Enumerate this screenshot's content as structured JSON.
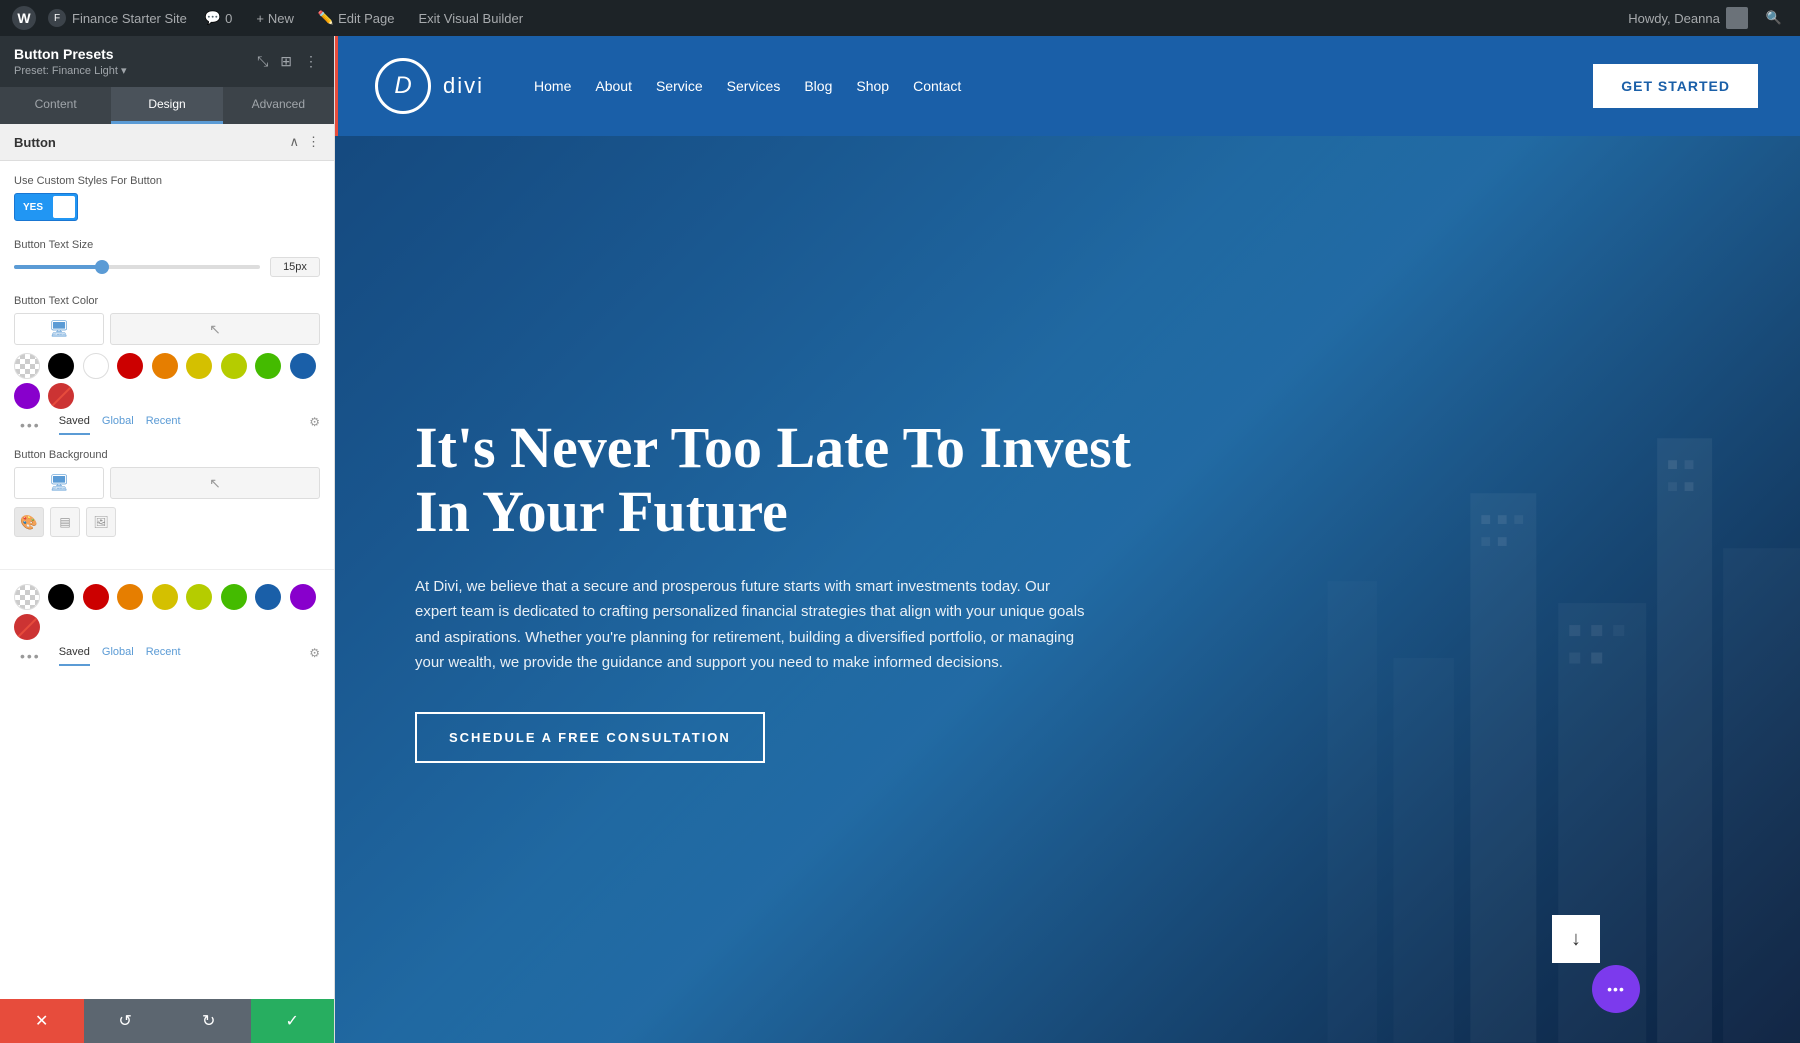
{
  "admin_bar": {
    "wp_icon": "W",
    "site_name": "Finance Starter Site",
    "comment_count": "0",
    "new_label": "New",
    "edit_page_label": "Edit Page",
    "exit_builder_label": "Exit Visual Builder",
    "howdy": "Howdy, Deanna",
    "search_icon": "🔍"
  },
  "panel": {
    "title": "Button Presets",
    "subtitle": "Preset: Finance Light ▾",
    "tabs": [
      "Content",
      "Design",
      "Advanced"
    ],
    "active_tab": "Design",
    "section_title": "Button",
    "toggle_label": "Use Custom Styles For Button",
    "toggle_value": "YES",
    "slider_label": "Button Text Size",
    "slider_value": "15px",
    "color_label": "Button Text Color",
    "bg_label": "Button Background",
    "color_tabs": [
      "Saved",
      "Global",
      "Recent"
    ],
    "active_color_tab": "Saved",
    "swatches": [
      {
        "id": "checkered",
        "color": "checkered"
      },
      {
        "id": "black",
        "color": "#000000"
      },
      {
        "id": "white",
        "color": "#ffffff"
      },
      {
        "id": "red",
        "color": "#cc0000"
      },
      {
        "id": "orange",
        "color": "#e67e00"
      },
      {
        "id": "yellow1",
        "color": "#d4c000"
      },
      {
        "id": "yellow2",
        "color": "#b5cc00"
      },
      {
        "id": "green",
        "color": "#44bb00"
      },
      {
        "id": "blue",
        "color": "#1a5fa8"
      },
      {
        "id": "purple",
        "color": "#8800cc"
      },
      {
        "id": "slash",
        "color": "#cc3333"
      }
    ],
    "bottom_swatches_label": "Saved",
    "bottom_swatches": [
      {
        "id": "checkered2",
        "color": "checkered"
      },
      {
        "id": "black2",
        "color": "#000000"
      },
      {
        "id": "red2",
        "color": "#cc0000"
      },
      {
        "id": "orange2",
        "color": "#e67e00"
      },
      {
        "id": "yellow3",
        "color": "#d4c000"
      },
      {
        "id": "yellow4",
        "color": "#b5cc00"
      },
      {
        "id": "green2",
        "color": "#44bb00"
      },
      {
        "id": "blue2",
        "color": "#1a5fa8"
      },
      {
        "id": "purple2",
        "color": "#8800cc"
      },
      {
        "id": "slash2",
        "color": "#cc3333"
      }
    ]
  },
  "bottom_bar": {
    "cancel_icon": "✕",
    "undo_icon": "↺",
    "redo_icon": "↻",
    "save_icon": "✓"
  },
  "site": {
    "logo_letter": "D",
    "logo_name": "divi",
    "nav_items": [
      "Home",
      "About",
      "Service",
      "Services",
      "Blog",
      "Shop",
      "Contact"
    ],
    "cta_button": "GET STARTED",
    "hero_title": "It's Never Too Late To Invest In Your Future",
    "hero_desc": "At Divi, we believe that a secure and prosperous future starts with smart investments today. Our expert team is dedicated to crafting personalized financial strategies that align with your unique goals and aspirations. Whether you're planning for retirement, building a diversified portfolio, or managing your wealth, we provide the guidance and support you need to make informed decisions.",
    "hero_cta": "SCHEDULE A FREE CONSULTATION",
    "scroll_down_icon": "↓",
    "fab_icon": "•••"
  }
}
